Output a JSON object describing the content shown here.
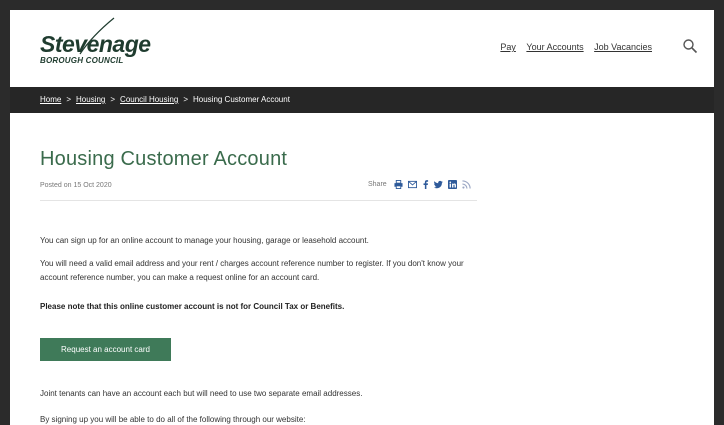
{
  "brand": {
    "name": "Stevenage",
    "sub": "BOROUGH COUNCIL",
    "color": "#1f3c2f"
  },
  "topnav": {
    "items": [
      "Pay",
      "Your Accounts",
      "Job Vacancies"
    ]
  },
  "search": {
    "icon": "search-icon"
  },
  "breadcrumb": {
    "items": [
      "Home",
      "Housing",
      "Council Housing",
      "Housing Customer Account"
    ],
    "separator": ">"
  },
  "main": {
    "title": "Housing Customer Account",
    "posted": "Posted on 15 Oct 2020",
    "share_label": "Share",
    "share_icons": [
      "print-icon",
      "email-icon",
      "facebook-icon",
      "twitter-icon",
      "linkedin-icon",
      "rss-icon"
    ],
    "paragraph1": "You can sign up for an online account to manage your housing, garage or leasehold account.",
    "paragraph2": "You will need a valid email address and your rent / charges account reference number to register. If you don't know your account reference number, you can make a request online for an account card.",
    "notice": "Please note that this online customer account is not for Council Tax or Benefits.",
    "button_label": "Request an account card",
    "paragraph3": "Joint tenants can have an account each but will need to use two separate email addresses.",
    "paragraph4": "By signing up you will be able to do all of the following through our website:"
  },
  "colors": {
    "accent": "#3a6b4c",
    "button": "#3f7a59",
    "crumbbar": "#262626"
  }
}
